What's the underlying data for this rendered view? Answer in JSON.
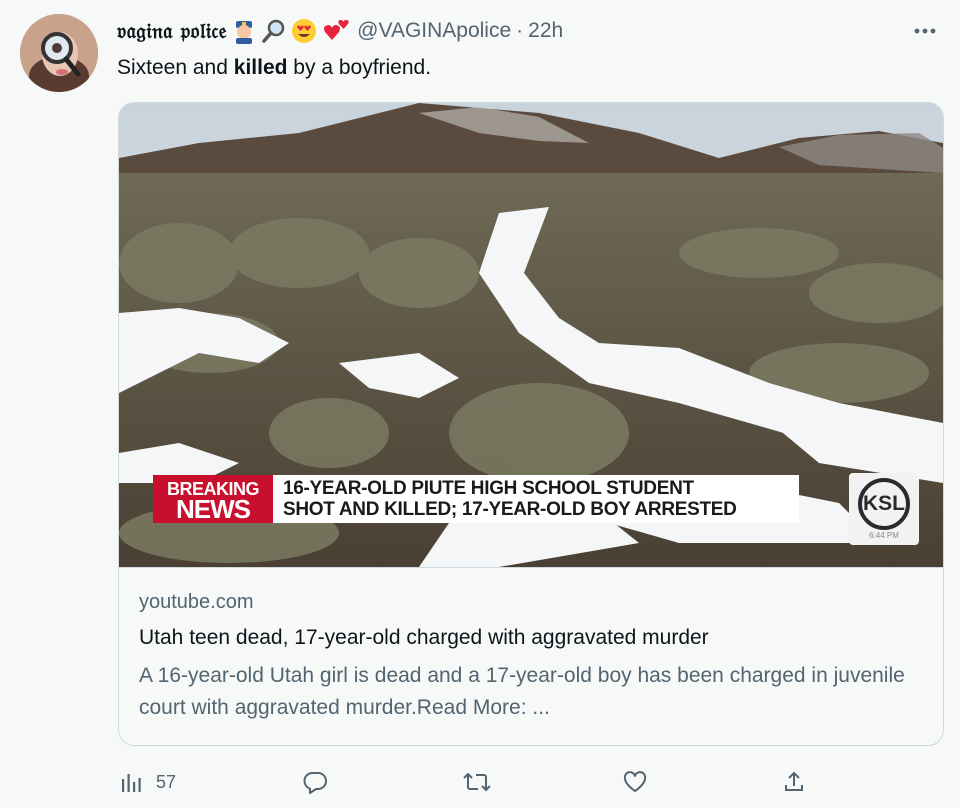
{
  "tweet": {
    "display_name": "𝔳𝔞𝔤𝔦𝔫𝔞 𝔭𝔬𝔩𝔦𝔠𝔢",
    "name_emojis": [
      "police-officer-icon",
      "magnifier-icon",
      "heart-eyes-icon",
      "two-hearts-icon"
    ],
    "handle": "@VAGINApolice",
    "separator": "·",
    "time": "22h",
    "text_before": "Sixteen and ",
    "text_bold": "killed",
    "text_after": " by a boyfriend."
  },
  "card": {
    "banner_left_line1": "BREAKING",
    "banner_left_line2": "NEWS",
    "banner_line1": "16-YEAR-OLD PIUTE HIGH SCHOOL STUDENT",
    "banner_line2": "SHOT AND KILLED; 17-YEAR-OLD BOY ARRESTED",
    "station_logo": "KSL",
    "station_time": "6:44 PM",
    "domain": "youtube.com",
    "title": "Utah teen dead, 17-year-old charged with aggravated murder",
    "description": "A 16-year-old Utah girl is dead and a 17-year-old boy has been charged in juvenile court with aggravated murder.Read More: ..."
  },
  "actions": {
    "views_count": "57",
    "icons": [
      "analytics-icon",
      "reply-icon",
      "retweet-icon",
      "like-icon",
      "share-icon"
    ]
  },
  "colors": {
    "text_primary": "#0f1419",
    "text_secondary": "#536471",
    "border": "#cfd9de",
    "background": "#f7f9f9",
    "breaking_red": "#c8102e"
  }
}
